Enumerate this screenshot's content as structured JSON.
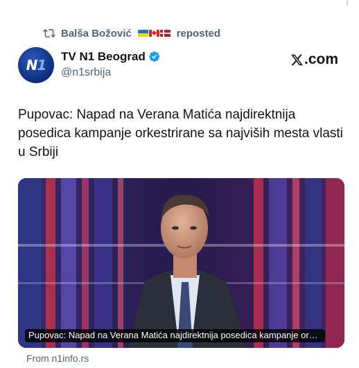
{
  "repost": {
    "user": "Balša Božović",
    "flags": [
      "ukraine",
      "canada",
      "denmark"
    ],
    "action": "reposted"
  },
  "author": {
    "display_name": "TV N1 Beograd",
    "handle": "@n1srbija",
    "verified": true,
    "avatar_logo": {
      "letter": "N",
      "digit": "1"
    }
  },
  "brand": {
    "text": ".com",
    "logo": "x-logo-icon"
  },
  "tweet": {
    "text": "Pupovac: Napad na Verana Matića najdirektnija posedica kampanje orkestrirane sa najviših mesta vlasti u Srbiji"
  },
  "card": {
    "caption": "Pupovac: Napad na Verana Matića najdirektnija posedica kampanje orkestrirane sa najviših mesta vlasti u Srbiji",
    "source": "From n1info.rs"
  },
  "colors": {
    "text_primary": "#0f1419",
    "text_secondary": "#536471",
    "verified_blue": "#1d9bf0",
    "n1_blue": "#0b2b78"
  }
}
